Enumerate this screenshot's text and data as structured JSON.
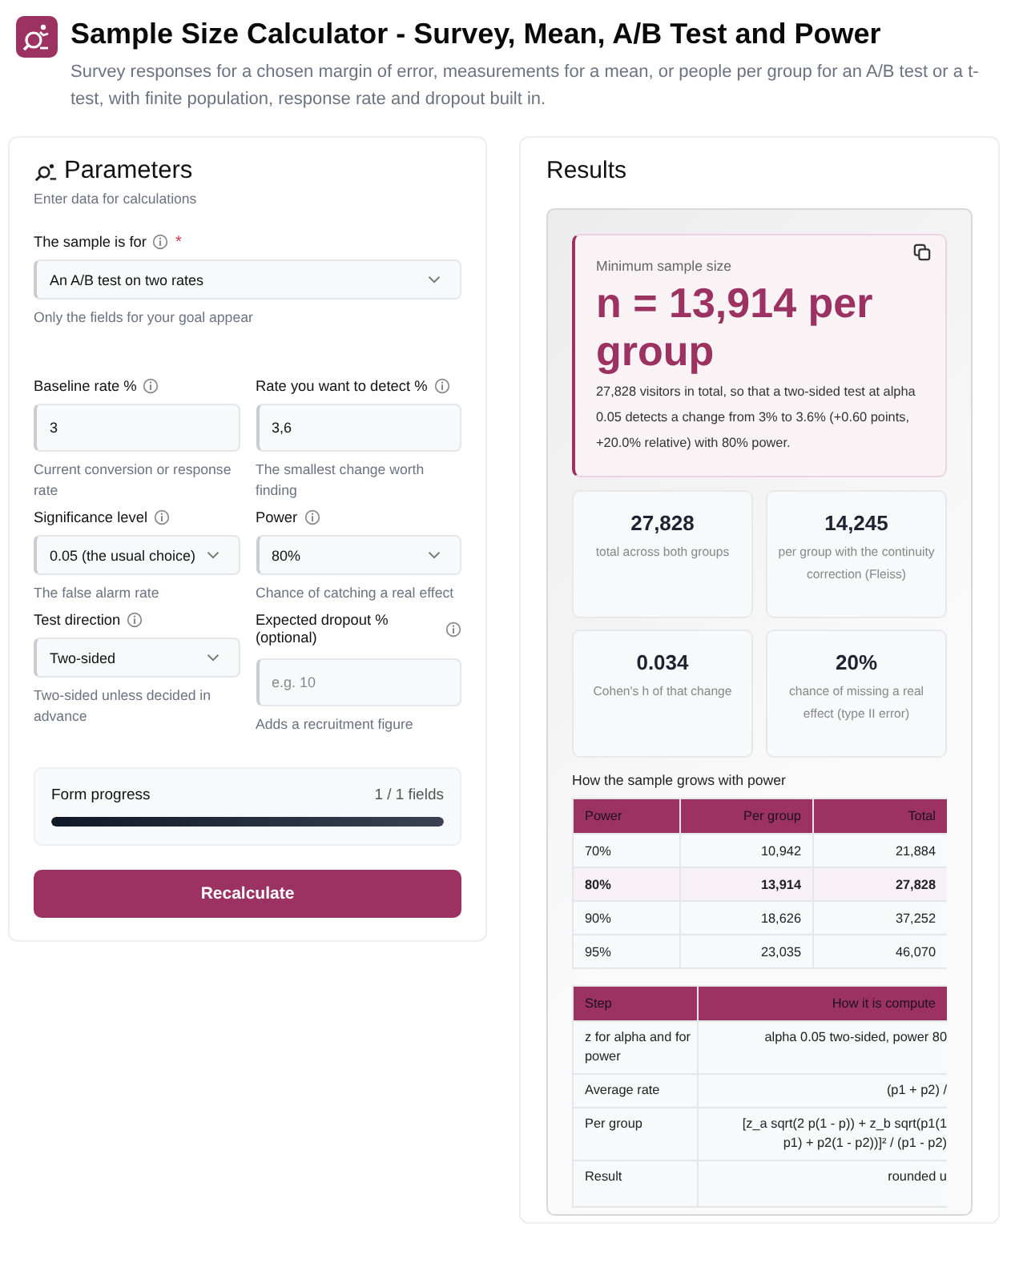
{
  "header": {
    "title": "Sample Size Calculator - Survey, Mean, A/B Test and Power",
    "subtitle": "Survey responses for a chosen margin of error, measurements for a mean, or people per group for an A/B test or a t-test, with finite population, response rate and dropout built in."
  },
  "parameters": {
    "title": "Parameters",
    "subtitle": "Enter data for calculations",
    "fields": [
      {
        "kind": "select",
        "wide": true,
        "label": "The sample is for",
        "required_mark": "*",
        "value": "An A/B test on two rates",
        "hint": "Only the fields for your goal appear"
      },
      {
        "kind": "input",
        "wide": false,
        "label": "Baseline rate %",
        "value": "3",
        "hint": "Current conversion or response rate"
      },
      {
        "kind": "input",
        "wide": false,
        "label": "Rate you want to detect %",
        "value": "3,6",
        "hint": "The smallest change worth finding"
      },
      {
        "kind": "select",
        "wide": false,
        "label": "Significance level",
        "value": "0.05 (the usual choice)",
        "hint": "The false alarm rate"
      },
      {
        "kind": "select",
        "wide": false,
        "label": "Power",
        "value": "80%",
        "hint": "Chance of catching a real effect"
      },
      {
        "kind": "select",
        "wide": false,
        "label": "Test direction",
        "value": "Two-sided",
        "hint": "Two-sided unless decided in advance"
      },
      {
        "kind": "input",
        "wide": false,
        "label": "Expected dropout % (optional)",
        "placeholder": "e.g. 10",
        "hint": "Adds a recruitment figure"
      }
    ],
    "progress": {
      "label": "Form progress",
      "count": "1 / 1 fields",
      "level": 1
    },
    "button": "Recalculate"
  },
  "results": {
    "title": "Results",
    "headline": {
      "label": "Minimum sample size",
      "value": "n = 13,914 per group",
      "summary": "27,828 visitors in total, so that a two-sided test at alpha 0.05 detects a change from 3% to 3.6% (+0.60 points, +20.0% relative) with 80% power."
    },
    "stats": [
      {
        "value": "27,828",
        "caption": "total across both groups"
      },
      {
        "value": "14,245",
        "caption": "per group with the continuity correction (Fleiss)"
      },
      {
        "value": "0.034",
        "caption": "Cohen's h of that change"
      },
      {
        "value": "20%",
        "caption": "chance of missing a real effect (type II error)"
      }
    ],
    "growth_table": {
      "caption": "How the sample grows with power",
      "columns": [
        "Power",
        "Per group",
        "Total"
      ],
      "rows": [
        {
          "cells": [
            "70%",
            "10,942",
            "21,884"
          ],
          "highlighted": false
        },
        {
          "cells": [
            "80%",
            "13,914",
            "27,828"
          ],
          "highlighted": true
        },
        {
          "cells": [
            "90%",
            "18,626",
            "37,252"
          ],
          "highlighted": false
        },
        {
          "cells": [
            "95%",
            "23,035",
            "46,070"
          ],
          "highlighted": false
        }
      ]
    },
    "steps_table": {
      "columns": [
        "Step",
        "How it is compute"
      ],
      "rows": [
        {
          "step": "z for alpha and for power",
          "lines": [
            "alpha 0.05 two-sided, power 80"
          ]
        },
        {
          "step": "Average rate",
          "lines": [
            "(p1 + p2) /"
          ]
        },
        {
          "step": "Per group",
          "lines": [
            "[z_a sqrt(2 p(1 - p)) + z_b sqrt(p1(1",
            "p1) + p2(1 - p2))]² / (p1 - p2)"
          ]
        },
        {
          "step": "Result",
          "lines": [
            "rounded u"
          ]
        }
      ]
    }
  }
}
